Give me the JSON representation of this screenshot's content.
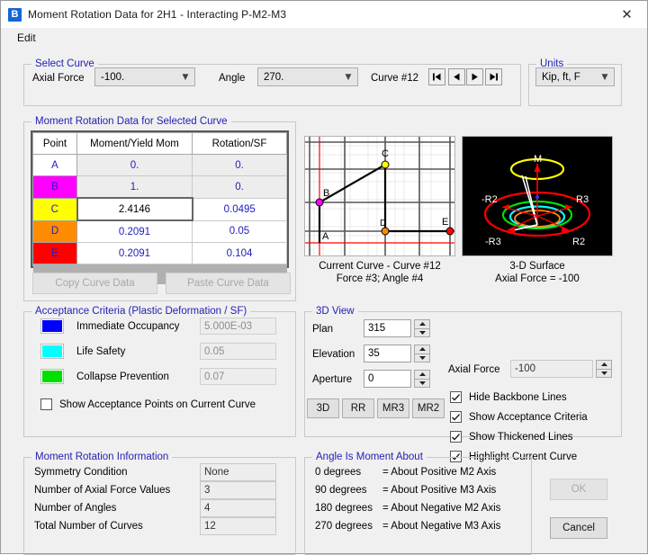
{
  "window": {
    "title": "Moment Rotation Data for 2H1 - Interacting P-M2-M3",
    "app_icon": "b-logo-icon",
    "close_icon": "close-icon"
  },
  "menubar": {
    "items": [
      "Edit"
    ]
  },
  "select_curve": {
    "legend": "Select Curve",
    "axial_force_label": "Axial Force",
    "axial_force_value": "-100.",
    "angle_label": "Angle",
    "angle_value": "270.",
    "curve_label": "Curve #12",
    "nav": [
      {
        "name": "first-curve-button",
        "glyph": "|◀"
      },
      {
        "name": "previous-curve-button",
        "glyph": "◀"
      },
      {
        "name": "next-curve-button",
        "glyph": "▶"
      },
      {
        "name": "last-curve-button",
        "glyph": "▶|"
      }
    ]
  },
  "units": {
    "legend": "Units",
    "value": "Kip, ft, F"
  },
  "data_table": {
    "legend": "Moment Rotation Data for Selected Curve",
    "headers": [
      "Point",
      "Moment/Yield Mom",
      "Rotation/SF"
    ],
    "rows": [
      {
        "point": "A",
        "moment": "0.",
        "rotation": "0.",
        "color": "#ffffff",
        "editable": false,
        "selected": false
      },
      {
        "point": "B",
        "moment": "1.",
        "rotation": "0.",
        "color": "#ff00ff",
        "editable": false,
        "selected": false
      },
      {
        "point": "C",
        "moment": "2.4146",
        "rotation": "0.0495",
        "color": "#ffff00",
        "editable": true,
        "selected": true
      },
      {
        "point": "D",
        "moment": "0.2091",
        "rotation": "0.05",
        "color": "#ff8c00",
        "editable": true,
        "selected": false
      },
      {
        "point": "E",
        "moment": "0.2091",
        "rotation": "0.104",
        "color": "#ff0000",
        "editable": true,
        "selected": false
      }
    ],
    "copy_button": "Copy Curve Data",
    "paste_button": "Paste Curve Data"
  },
  "acceptance": {
    "legend": "Acceptance Criteria (Plastic Deformation / SF)",
    "rows": [
      {
        "label": "Immediate Occupancy",
        "value": "5.000E-03",
        "color": "#0000ff"
      },
      {
        "label": "Life Safety",
        "value": "0.05",
        "color": "#00ffff"
      },
      {
        "label": "Collapse Prevention",
        "value": "0.07",
        "color": "#00e000"
      }
    ],
    "checkbox_label": "Show Acceptance Points on Current Curve",
    "checkbox_checked": false
  },
  "curve_plot": {
    "caption_line1": "Current Curve - Curve #12",
    "caption_line2": "Force #3;  Angle #4",
    "points": [
      {
        "label": "A",
        "color": "#ff00ff"
      },
      {
        "label": "B",
        "color": "#ff00ff"
      },
      {
        "label": "C",
        "color": "#ffff00"
      },
      {
        "label": "D",
        "color": "#ff8c00"
      },
      {
        "label": "E",
        "color": "#ff0000"
      }
    ]
  },
  "surface_plot": {
    "caption_line1": "3-D Surface",
    "caption_line2": "Axial Force = -100",
    "labels": [
      "M",
      "-R2",
      "R3",
      "-R3",
      "R2"
    ]
  },
  "view3d": {
    "legend": "3D View",
    "plan_label": "Plan",
    "plan_value": "315",
    "elevation_label": "Elevation",
    "elevation_value": "35",
    "aperture_label": "Aperture",
    "aperture_value": "0",
    "axial_force_label": "Axial Force",
    "axial_force_value": "-100",
    "buttons": [
      "3D",
      "RR",
      "MR3",
      "MR2"
    ],
    "checkboxes": [
      {
        "label": "Hide Backbone Lines",
        "checked": true
      },
      {
        "label": "Show Acceptance Criteria",
        "checked": true
      },
      {
        "label": "Show Thickened Lines",
        "checked": true
      },
      {
        "label": "Highlight Current Curve",
        "checked": true
      }
    ]
  },
  "info": {
    "legend": "Moment Rotation Information",
    "rows": [
      {
        "label": "Symmetry Condition",
        "value": "None"
      },
      {
        "label": "Number of Axial Force Values",
        "value": "3"
      },
      {
        "label": "Number of Angles",
        "value": "4"
      },
      {
        "label": "Total Number of Curves",
        "value": "12"
      }
    ]
  },
  "angle_info": {
    "legend": "Angle Is Moment About",
    "rows": [
      {
        "angle": "0 degrees",
        "desc": "= About Positive M2 Axis"
      },
      {
        "angle": "90 degrees",
        "desc": "= About Positive M3 Axis"
      },
      {
        "angle": "180 degrees",
        "desc": "= About Negative M2 Axis"
      },
      {
        "angle": "270 degrees",
        "desc": "= About Negative M3 Axis"
      }
    ]
  },
  "actions": {
    "ok_label": "OK",
    "ok_enabled": false,
    "cancel_label": "Cancel",
    "cancel_enabled": true
  }
}
